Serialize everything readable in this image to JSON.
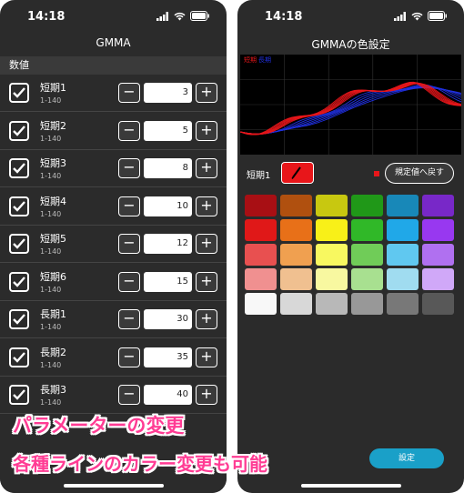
{
  "left": {
    "status_time": "14:18",
    "title": "GMMA",
    "section_header": "数値",
    "rows": [
      {
        "name": "短期1",
        "range": "1-140",
        "value": "3"
      },
      {
        "name": "短期2",
        "range": "1-140",
        "value": "5"
      },
      {
        "name": "短期3",
        "range": "1-140",
        "value": "8"
      },
      {
        "name": "短期4",
        "range": "1-140",
        "value": "10"
      },
      {
        "name": "短期5",
        "range": "1-140",
        "value": "12"
      },
      {
        "name": "短期6",
        "range": "1-140",
        "value": "15"
      },
      {
        "name": "長期1",
        "range": "1-140",
        "value": "30"
      },
      {
        "name": "長期2",
        "range": "1-140",
        "value": "35"
      },
      {
        "name": "長期3",
        "range": "1-140",
        "value": "40"
      }
    ],
    "minus_label": "−",
    "plus_label": "+"
  },
  "right": {
    "status_time": "14:18",
    "title": "GMMAの色設定",
    "legend_short": "短期",
    "legend_long": "長期",
    "selected_label": "短期1",
    "selected_color": "#e8161a",
    "reset_label": "規定値へ戻す",
    "settings_label": "設定",
    "palette": [
      [
        "#a80f14",
        "#b0500f",
        "#c8c810",
        "#209818",
        "#1888b8",
        "#7828c8"
      ],
      [
        "#e01818",
        "#e87018",
        "#f8f018",
        "#30b828",
        "#20a8e8",
        "#9838f0"
      ],
      [
        "#e85050",
        "#f0a050",
        "#f8f860",
        "#70cc58",
        "#60c8f0",
        "#b070f0"
      ],
      [
        "#f09090",
        "#f0c090",
        "#f8f8a0",
        "#a8e090",
        "#a0dcf0",
        "#d0a8f8"
      ],
      [
        "#f8f8f8",
        "#d8d8d8",
        "#b8b8b8",
        "#989898",
        "#787878",
        "#585858"
      ]
    ]
  },
  "captions": {
    "line1": "パラメーターの変更",
    "line2": "各種ラインのカラー変更も可能"
  },
  "colors": {
    "background_dark": "#2b2b2b",
    "accent_button": "#1aa0c8",
    "caption_pink": "#ff3c94",
    "short_series": "#e8161a",
    "long_series": "#2030e0"
  }
}
